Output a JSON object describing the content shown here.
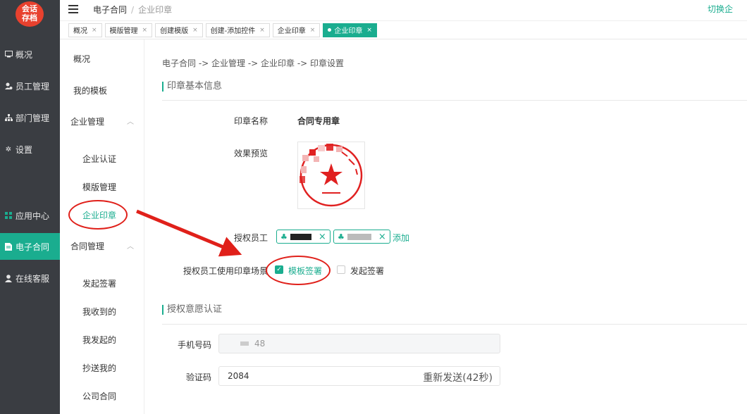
{
  "logo": {
    "line1": "会话",
    "line2": "存档"
  },
  "left_nav": [
    {
      "label": "概况",
      "icon": "monitor-icon"
    },
    {
      "label": "员工管理",
      "icon": "users-icon"
    },
    {
      "label": "部门管理",
      "icon": "org-icon"
    },
    {
      "label": "设置",
      "icon": "gear-icon"
    },
    {
      "label": "应用中心",
      "icon": "grid-icon"
    },
    {
      "label": "电子合同",
      "icon": "document-icon"
    },
    {
      "label": "在线客服",
      "icon": "person-icon"
    }
  ],
  "topbar": {
    "crumb_root": "电子合同",
    "crumb_sep": "/",
    "crumb_current": "企业印章",
    "switch_label": "切换企"
  },
  "tabs": [
    {
      "label": "概况"
    },
    {
      "label": "模版管理"
    },
    {
      "label": "创建模版"
    },
    {
      "label": "创建-添加控件"
    },
    {
      "label": "企业印章"
    },
    {
      "label": "企业印章"
    }
  ],
  "subnav": {
    "overview": "概况",
    "my_templates": "我的模板",
    "group_enterprise": "企业管理",
    "ent_children": [
      "企业认证",
      "模版管理",
      "企业印章"
    ],
    "group_contract": "合同管理",
    "contract_children": [
      "发起签署",
      "我收到的",
      "我发起的",
      "抄送我的",
      "公司合同"
    ]
  },
  "main": {
    "path": "电子合同 -> 企业管理 -> 企业印章 -> 印章设置",
    "section1": "印章基本信息",
    "seal_name_label": "印章名称",
    "seal_name_value": "合同专用章",
    "preview_label": "效果预览",
    "authorized_label": "授权员工",
    "add_label": "添加",
    "scene_label": "授权员工使用印章场景",
    "scene_options": [
      {
        "label": "模板签署",
        "checked": true
      },
      {
        "label": "发起签署",
        "checked": false
      }
    ],
    "section2": "授权意愿认证",
    "phone_label": "手机号码",
    "phone_value": "48",
    "code_label": "验证码",
    "code_value": "2084",
    "resend_label": "重新发送(42秒)"
  },
  "colors": {
    "accent": "#1aad8f",
    "nav_bg": "#3a3d42",
    "annotation": "#e0201a",
    "seal": "#e02020"
  }
}
